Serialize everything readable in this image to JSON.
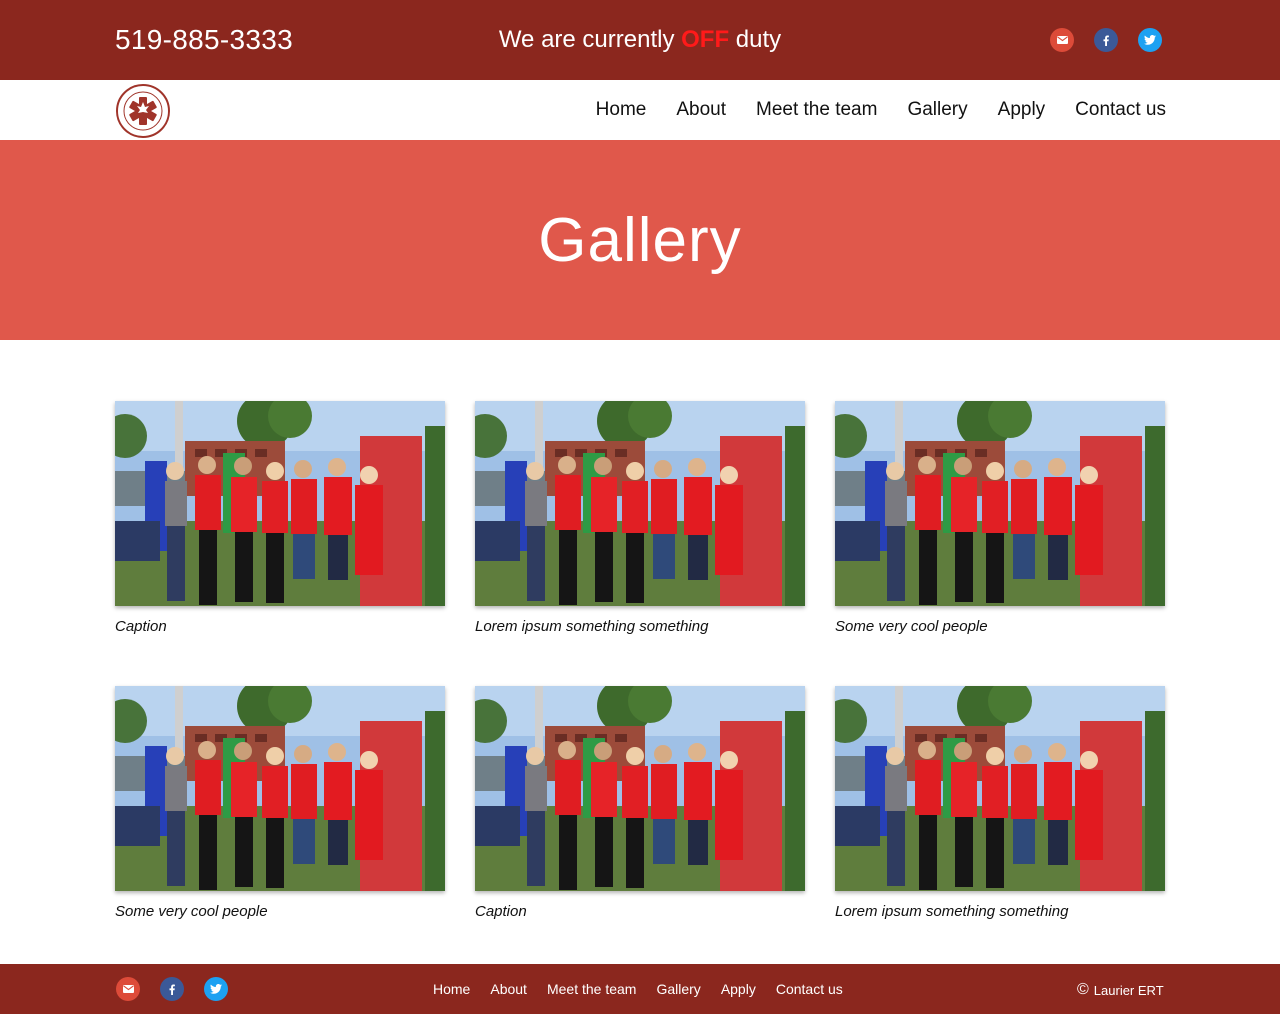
{
  "topbar": {
    "phone": "519-885-3333",
    "status_prefix": "We are currently",
    "status_value": "OFF",
    "status_suffix": "duty",
    "social": [
      "mail-icon",
      "facebook-icon",
      "twitter-icon"
    ]
  },
  "navbar": {
    "items": [
      "Home",
      "About",
      "Meet the team",
      "Gallery",
      "Apply",
      "Contact us"
    ]
  },
  "hero": {
    "title": "Gallery"
  },
  "gallery": {
    "items": [
      {
        "caption": "Caption"
      },
      {
        "caption": "Lorem ipsum something something"
      },
      {
        "caption": "Some very cool people"
      },
      {
        "caption": "Some very cool people"
      },
      {
        "caption": "Caption"
      },
      {
        "caption": "Lorem ipsum something something"
      }
    ]
  },
  "footer": {
    "items": [
      "Home",
      "About",
      "Meet the team",
      "Gallery",
      "Apply",
      "Contact us"
    ],
    "copyright": "Laurier ERT",
    "social": [
      "mail-icon",
      "facebook-icon",
      "twitter-icon"
    ]
  },
  "colors": {
    "topbar": "#8b271e",
    "hero": "#e0584b",
    "off_text": "#ff1a1a",
    "mail": "#dd4b39",
    "facebook": "#3b5998",
    "twitter": "#1da1f2"
  }
}
